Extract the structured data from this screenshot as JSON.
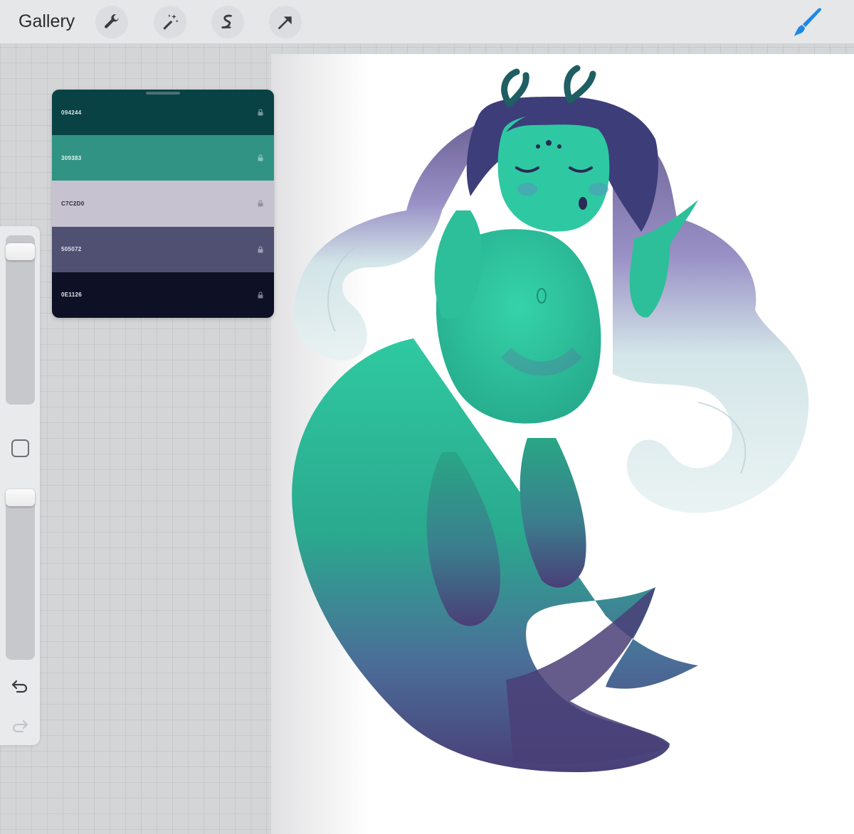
{
  "app": {
    "gallery_label": "Gallery"
  },
  "toolbar": {
    "tools": [
      "wrench-icon",
      "magic-wand-icon",
      "selection-icon",
      "transform-arrow-icon"
    ],
    "brush_icon": "brush-icon",
    "brush_color": "#1e88e5"
  },
  "palette": {
    "swatches": [
      {
        "hex": "094244",
        "color": "#094244",
        "text_color": "#d9e4e4"
      },
      {
        "hex": "309383",
        "color": "#309383",
        "text_color": "#e7f3f1"
      },
      {
        "hex": "C7C2D0",
        "color": "#c7c2d0",
        "text_color": "#2a2a33"
      },
      {
        "hex": "505072",
        "color": "#505072",
        "text_color": "#e3e3ee"
      },
      {
        "hex": "0E1126",
        "color": "#0e1126",
        "text_color": "#e6e7ef"
      }
    ]
  },
  "sidebar": {
    "brush_size": 0.94,
    "opacity": 0.92,
    "modify_icon": "square-icon",
    "undo_icon": "undo-icon",
    "redo_icon": "redo-icon"
  }
}
